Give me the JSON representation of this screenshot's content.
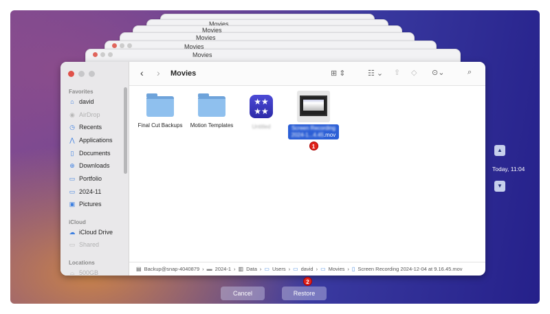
{
  "window": {
    "title": "Movies",
    "ghost_title": "Movies"
  },
  "sidebar": {
    "favorites_label": "Favorites",
    "favorites": [
      {
        "label": "david",
        "icon": "home-icon"
      },
      {
        "label": "AirDrop",
        "icon": "airdrop-icon"
      },
      {
        "label": "Recents",
        "icon": "clock-icon"
      },
      {
        "label": "Applications",
        "icon": "applications-icon"
      },
      {
        "label": "Documents",
        "icon": "document-icon"
      },
      {
        "label": "Downloads",
        "icon": "download-icon"
      },
      {
        "label": "Portfolio",
        "icon": "folder-icon"
      },
      {
        "label": "2024-11",
        "icon": "folder-icon"
      },
      {
        "label": "Pictures",
        "icon": "pictures-icon"
      }
    ],
    "icloud_label": "iCloud",
    "icloud": [
      {
        "label": "iCloud Drive",
        "icon": "cloud-icon"
      },
      {
        "label": "Shared",
        "icon": "shared-folder-icon"
      }
    ],
    "locations_label": "Locations",
    "locations": [
      {
        "label": "500GB",
        "icon": "disk-icon"
      }
    ]
  },
  "files": [
    {
      "name": "Final Cut Backups",
      "type": "folder"
    },
    {
      "name": "Motion Templates",
      "type": "folder"
    },
    {
      "name": "Untitled",
      "type": "app"
    },
    {
      "name_blurred": "Screen Recording 2024-1...4.45",
      "name_ext": ".mov",
      "type": "video",
      "selected": true,
      "badge": "1"
    }
  ],
  "path": [
    "Backup@snap-4040879",
    "2024-1",
    "Data",
    "Users",
    "david",
    "Movies",
    "Screen Recording 2024-12-04 at 9.16.45.mov"
  ],
  "buttons": {
    "cancel": "Cancel",
    "restore": "Restore",
    "restore_badge": "2"
  },
  "timeline": {
    "label": "Today, 11:04"
  }
}
